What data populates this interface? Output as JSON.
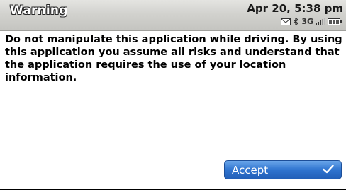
{
  "titlebar": {
    "title": "Warning",
    "datetime": "Apr 20, 5:38 pm",
    "status": {
      "signal_label": "3G",
      "icons": [
        "message-icon",
        "bluetooth-icon",
        "network-3g-icon",
        "signal-bars-icon",
        "battery-icon"
      ]
    }
  },
  "dialog": {
    "message": "Do not manipulate this application while driving.  By using this application you assume all risks and understand that the application requires the use of your location information.",
    "accept_label": "Accept",
    "accept_icon": "checkmark-icon",
    "accent_color": "#2f74cf"
  }
}
